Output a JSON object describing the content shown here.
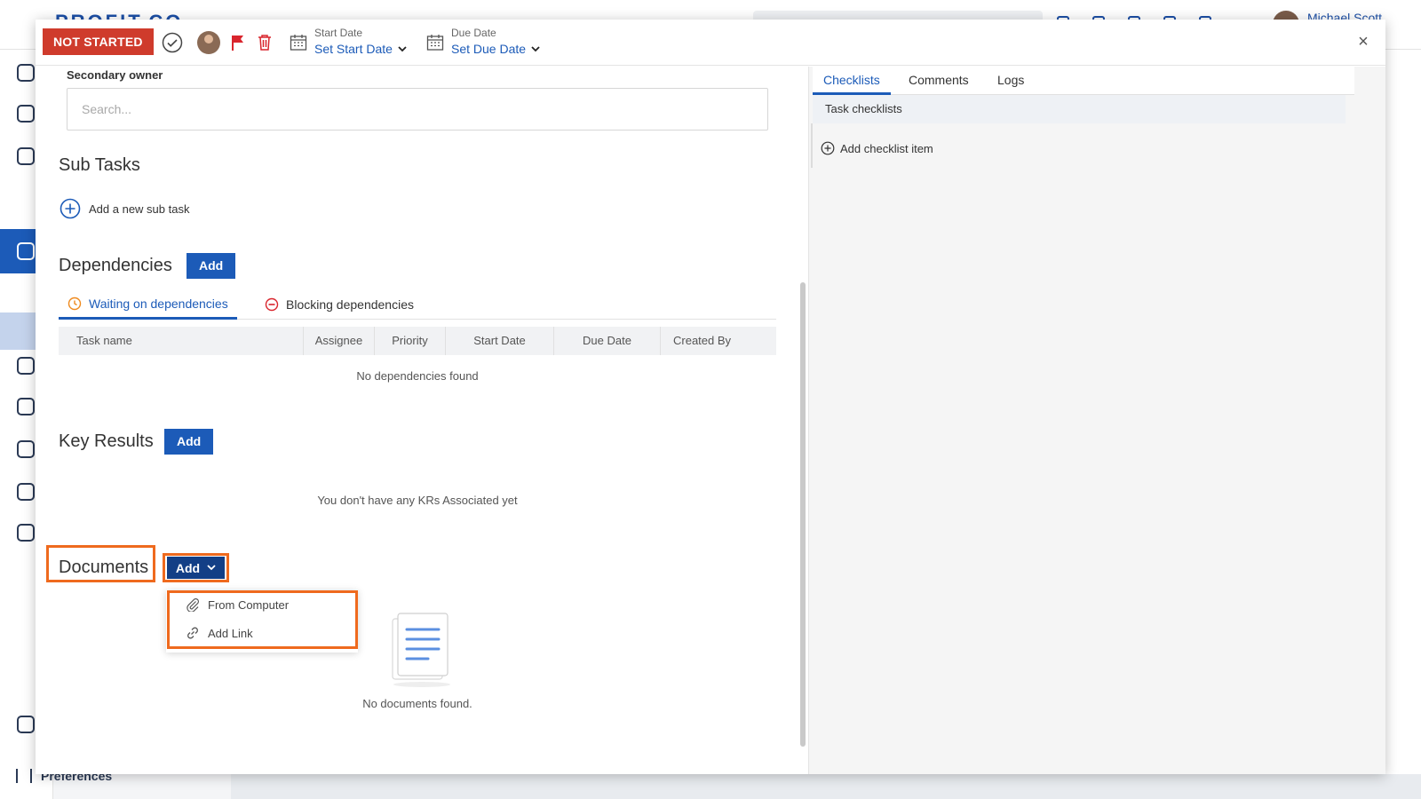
{
  "background": {
    "logo": "PROFIT.CO",
    "user_name": "Michael Scott",
    "preferences_label": "Preferences"
  },
  "header": {
    "status": "NOT STARTED",
    "start_date": {
      "label": "Start Date",
      "value": "Set Start Date"
    },
    "due_date": {
      "label": "Due Date",
      "value": "Set Due Date"
    },
    "close": "×"
  },
  "secondary_owner": {
    "label": "Secondary owner",
    "placeholder": "Search..."
  },
  "sub_tasks": {
    "title": "Sub Tasks",
    "add_label": "Add a new sub task"
  },
  "dependencies": {
    "title": "Dependencies",
    "add_label": "Add",
    "tabs": [
      {
        "label": "Waiting on dependencies"
      },
      {
        "label": "Blocking dependencies"
      }
    ],
    "columns": [
      "Task name",
      "Assignee",
      "Priority",
      "Start Date",
      "Due Date",
      "Created By"
    ],
    "empty": "No dependencies found"
  },
  "key_results": {
    "title": "Key Results",
    "add_label": "Add",
    "empty": "You don't have any KRs Associated yet"
  },
  "documents": {
    "title": "Documents",
    "add_label": "Add",
    "menu": [
      {
        "label": "From Computer",
        "icon": "paperclip-icon"
      },
      {
        "label": "Add Link",
        "icon": "link-icon"
      }
    ],
    "empty": "No documents found."
  },
  "right_panel": {
    "tabs": [
      {
        "label": "Checklists"
      },
      {
        "label": "Comments"
      },
      {
        "label": "Logs"
      }
    ],
    "list_header": "Task checklists",
    "add_item": "Add checklist item"
  },
  "colors": {
    "status_red": "#cf3b2c",
    "primary_blue": "#1c5bb8",
    "highlight_orange": "#ef6a1e"
  }
}
